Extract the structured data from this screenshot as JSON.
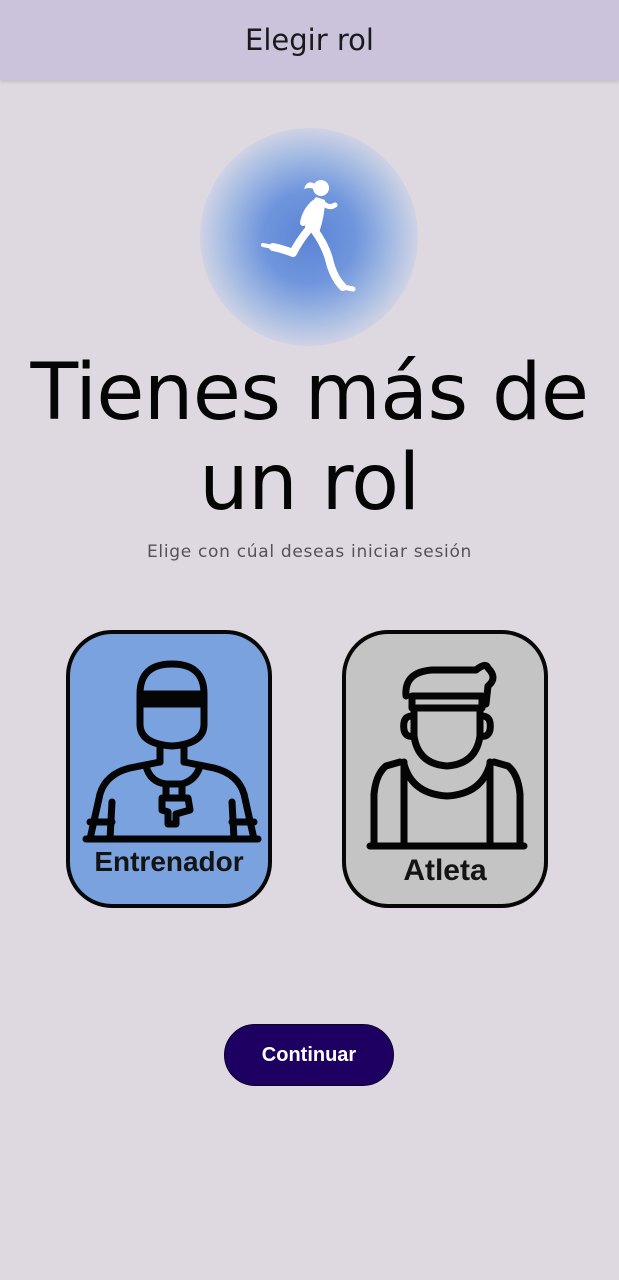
{
  "appbar": {
    "title": "Elegir rol"
  },
  "logo": {
    "icon": "running-woman-icon"
  },
  "main": {
    "headline_line1": "Tienes más de",
    "headline_line2": "un rol",
    "subtitle": "Elige con cúal deseas iniciar sesión"
  },
  "roles": [
    {
      "label": "Entrenador",
      "icon": "coach-icon",
      "color": "#7aa2df"
    },
    {
      "label": "Atleta",
      "icon": "athlete-icon",
      "color": "#c4c4c4"
    }
  ],
  "actions": {
    "continue_label": "Continuar",
    "continue_color": "#1e0063"
  }
}
